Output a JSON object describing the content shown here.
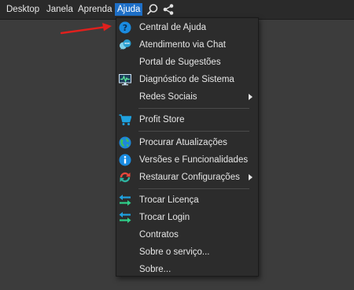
{
  "menubar": {
    "items": [
      "Desktop",
      "Janela",
      "Aprenda",
      "Ajuda"
    ],
    "active": "Ajuda"
  },
  "icons": {
    "search": "search-icon",
    "share": "share-icon"
  },
  "colors": {
    "accent": "#1e6fc7",
    "annotation_arrow": "#e0201d"
  },
  "help_menu": {
    "items": [
      {
        "label": "Central de Ajuda",
        "icon": "question-circle-icon"
      },
      {
        "label": "Atendimento via Chat",
        "icon": "chat-bubble-icon"
      },
      {
        "label": "Portal de Sugestões",
        "icon": ""
      },
      {
        "label": "Diagnóstico de Sistema",
        "icon": "monitor-pulse-icon"
      },
      {
        "label": "Redes Sociais",
        "icon": "",
        "submenu": true
      },
      {
        "label": "Profit Store",
        "icon": "shopping-cart-icon"
      },
      {
        "label": "Procurar Atualizações",
        "icon": "globe-icon"
      },
      {
        "label": "Versões e Funcionalidades",
        "icon": "info-circle-icon"
      },
      {
        "label": "Restaurar Configurações",
        "icon": "restore-icon",
        "submenu": true
      },
      {
        "label": "Trocar Licença",
        "icon": "swap-arrows-icon"
      },
      {
        "label": "Trocar Login",
        "icon": "swap-arrows-icon"
      },
      {
        "label": "Contratos",
        "icon": ""
      },
      {
        "label": "Sobre o serviço...",
        "icon": ""
      },
      {
        "label": "Sobre...",
        "icon": ""
      }
    ]
  }
}
